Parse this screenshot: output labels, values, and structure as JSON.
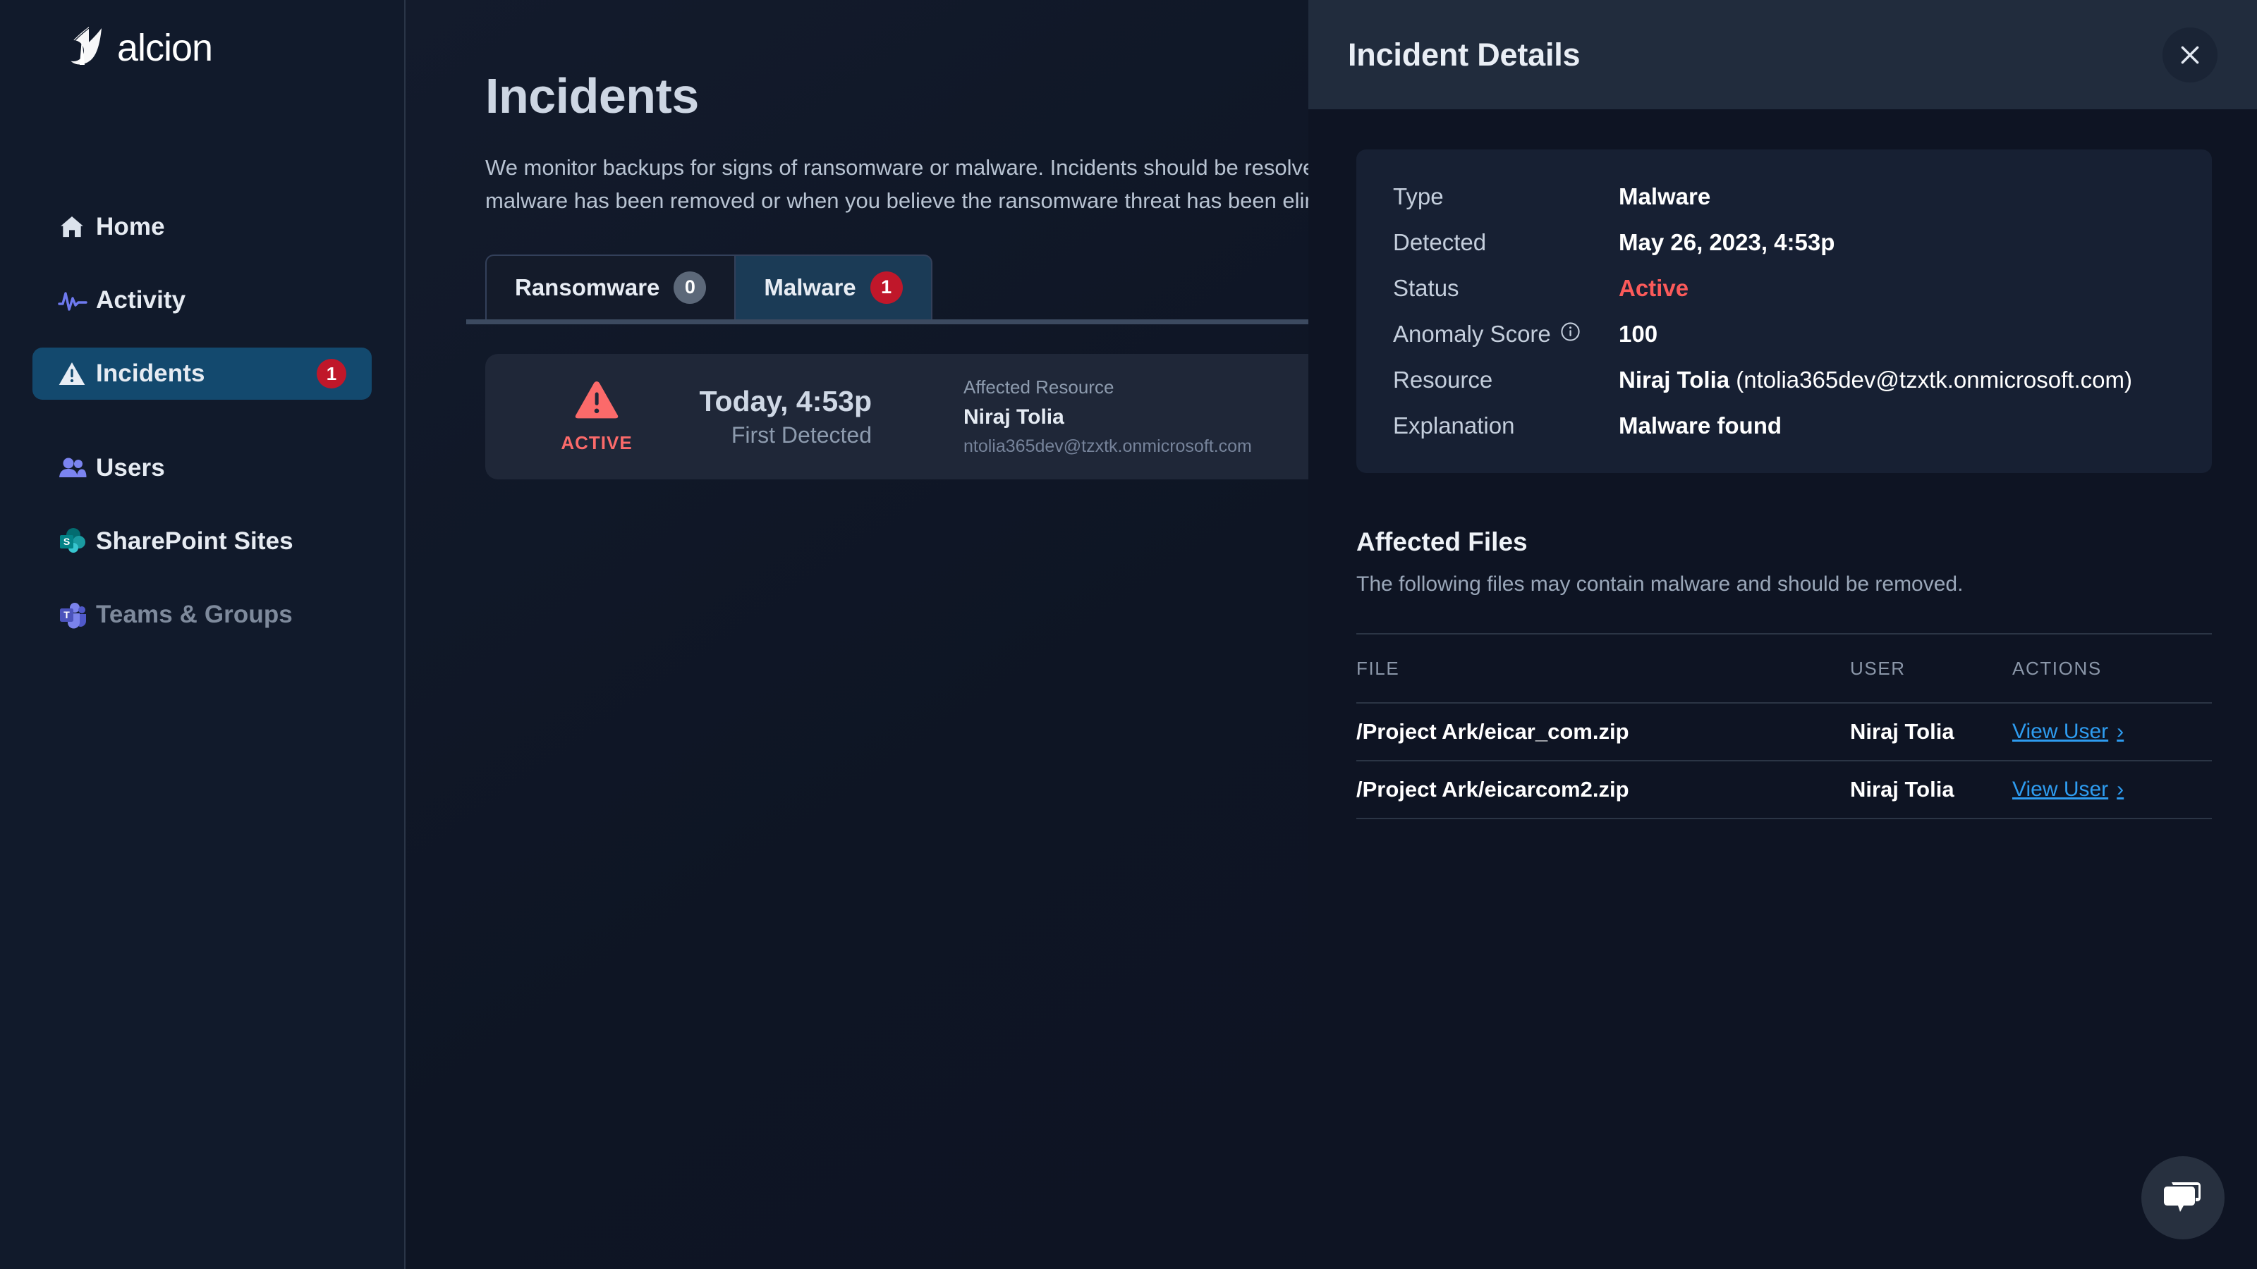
{
  "brand": {
    "name": "alcion",
    "logo_icon": "alcion-logo-icon"
  },
  "sidebar": {
    "items": [
      {
        "label": "Home",
        "icon": "home-icon",
        "badge": null,
        "active": false,
        "muted": false
      },
      {
        "label": "Activity",
        "icon": "activity-pulse-icon",
        "badge": null,
        "active": false,
        "muted": false
      },
      {
        "label": "Incidents",
        "icon": "warning-triangle-icon",
        "badge": "1",
        "active": true,
        "muted": false
      },
      {
        "label": "Users",
        "icon": "users-icon",
        "badge": null,
        "active": false,
        "muted": false
      },
      {
        "label": "SharePoint Sites",
        "icon": "sharepoint-icon",
        "badge": null,
        "active": false,
        "muted": false
      },
      {
        "label": "Teams & Groups",
        "icon": "teams-icon",
        "badge": null,
        "active": false,
        "muted": true
      }
    ]
  },
  "main": {
    "title": "Incidents",
    "description": "We monitor backups for signs of ransomware or malware. Incidents should be resolved when malware has been removed or when you believe the ransomware threat has been eliminated.",
    "tabs": [
      {
        "label": "Ransomware",
        "count": "0",
        "selected": false,
        "count_color": "#5c6879"
      },
      {
        "label": "Malware",
        "count": "1",
        "selected": true,
        "count_color": "#c0172a"
      }
    ],
    "incident_card": {
      "status_icon": "warning-triangle-icon",
      "status_label": "ACTIVE",
      "time": "Today, 4:53p",
      "time_sub": "First Detected",
      "resource_label": "Affected Resource",
      "resource_name": "Niraj Tolia",
      "resource_email": "ntolia365dev@tzxtk.onmicrosoft.com"
    }
  },
  "panel": {
    "title": "Incident Details",
    "close_icon": "close-icon",
    "details": [
      {
        "key": "Type",
        "value": "Malware",
        "info": false,
        "danger": false,
        "suffix": ""
      },
      {
        "key": "Detected",
        "value": "May 26, 2023, 4:53p",
        "info": false,
        "danger": false,
        "suffix": ""
      },
      {
        "key": "Status",
        "value": "Active",
        "info": false,
        "danger": true,
        "suffix": ""
      },
      {
        "key": "Anomaly Score",
        "value": "100",
        "info": true,
        "danger": false,
        "suffix": ""
      },
      {
        "key": "Resource",
        "value": "Niraj Tolia",
        "info": false,
        "danger": false,
        "suffix": " (ntolia365dev@tzxtk.onmicrosoft.com)"
      },
      {
        "key": "Explanation",
        "value": "Malware found",
        "info": false,
        "danger": false,
        "suffix": ""
      }
    ],
    "info_icon": "info-circle-icon",
    "files": {
      "title": "Affected Files",
      "subtitle": "The following files may contain malware and should be removed.",
      "columns": [
        "FILE",
        "USER",
        "ACTIONS"
      ],
      "rows": [
        {
          "file": "/Project Ark/eicar_com.zip",
          "user": "Niraj Tolia",
          "action": "View User",
          "action_icon": "chevron-right-icon"
        },
        {
          "file": "/Project Ark/eicarcom2.zip",
          "user": "Niraj Tolia",
          "action": "View User",
          "action_icon": "chevron-right-icon"
        }
      ]
    }
  },
  "chat": {
    "icon": "chat-bubble-icon"
  },
  "colors": {
    "accent_blue": "#13496e",
    "danger_red": "#c0172a",
    "status_red": "#fb5a5a",
    "link_blue": "#2e9cf0",
    "sidebar_bg": "#111a2b",
    "panel_bg": "#0e1423",
    "panel_header_bg": "#212c3d"
  }
}
